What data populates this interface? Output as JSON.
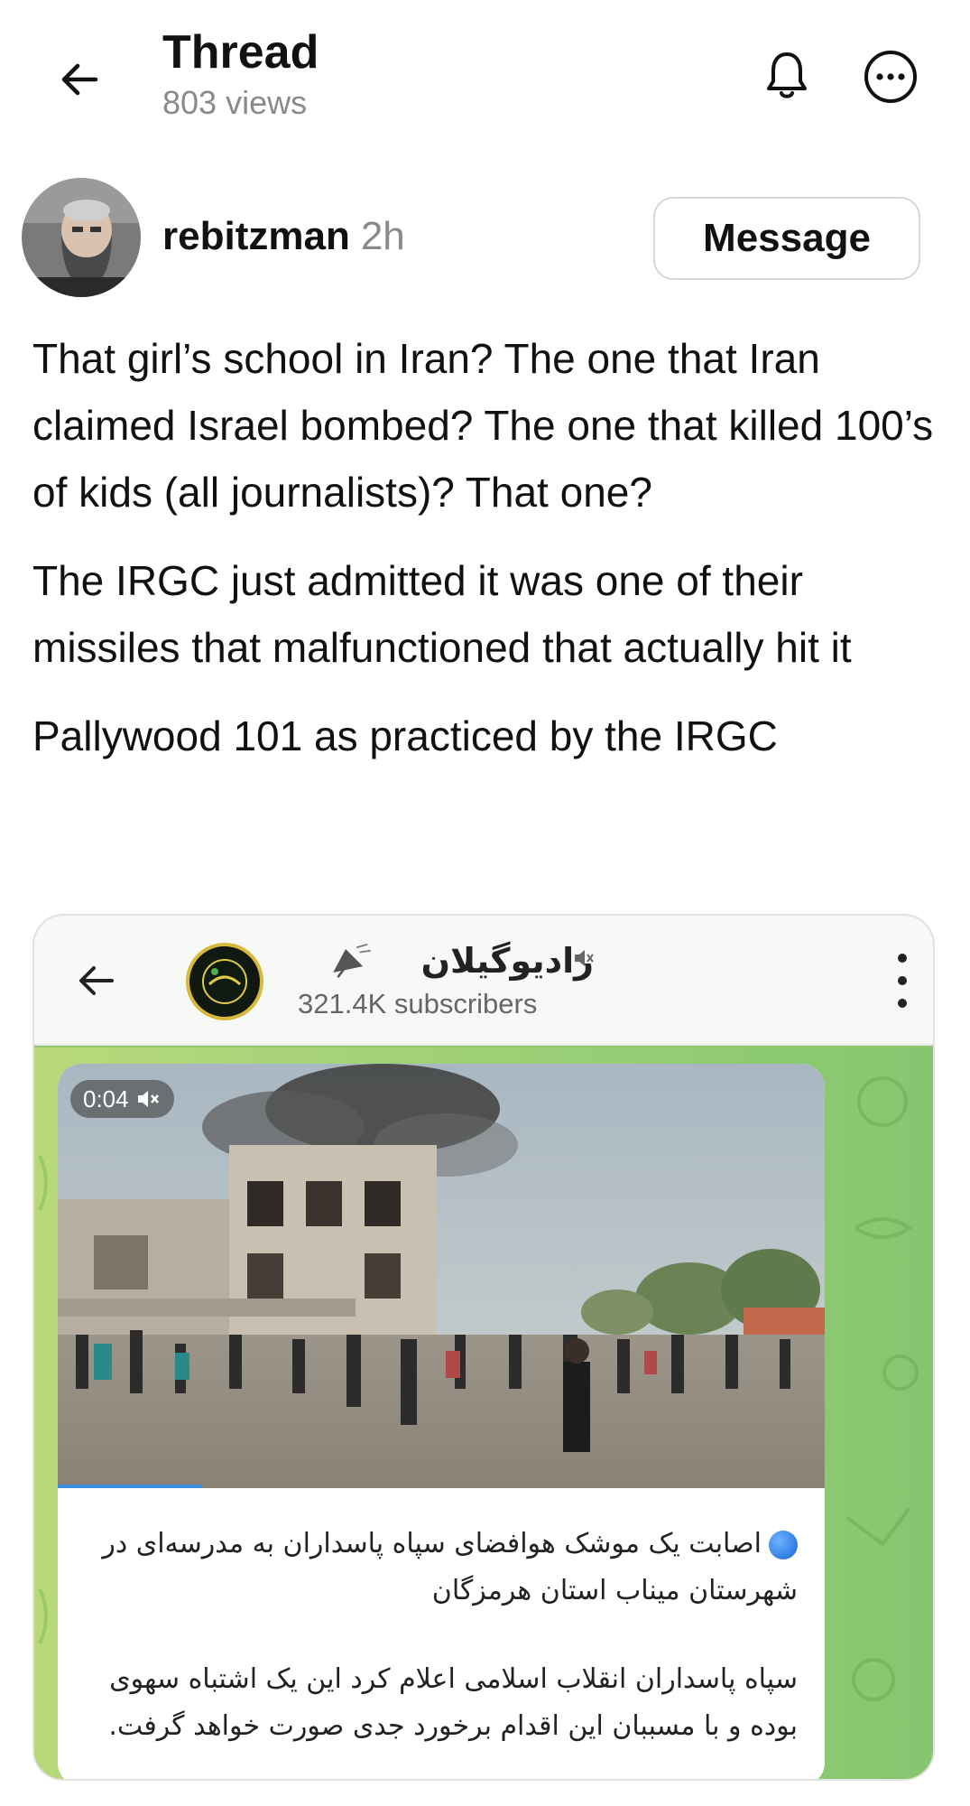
{
  "header": {
    "title": "Thread",
    "views": "803 views"
  },
  "post": {
    "username": "rebitzman",
    "time_ago": "2h",
    "message_button": "Message",
    "paragraphs": [
      "That girl’s school in Iran?  The one that Iran claimed Israel bombed?  The one that killed 100’s of kids (all journalists)? That one?",
      "The IRGC just admitted it was one of their missiles that malfunctioned that actually hit it",
      "Pallywood 101 as practiced by the IRGC"
    ]
  },
  "embed": {
    "channel_name": "راديوگيلان",
    "subscribers": "321.4K subscribers",
    "video_time": "0:04",
    "caption_1": "اصابت یک موشک هوافضای سپاه پاسداران به مدرسه‌ای در شهرستان میناب استان هرمزگان",
    "caption_2": "سپاه پاسداران انقلاب اسلامی اعلام کرد این یک اشتباه سهوی بوده و با مسببان این اقدام برخورد جدی صورت خواهد گرفت."
  },
  "icons": {
    "back": "back-arrow-icon",
    "bell": "bell-icon",
    "more": "more-options-icon",
    "mute": "mute-icon",
    "kebab": "kebab-menu-icon"
  },
  "colors": {
    "text_primary": "#111111",
    "text_secondary": "#8a8a8a",
    "telegram_green": "#8fc86c",
    "progress_blue": "#3a8ee0"
  }
}
